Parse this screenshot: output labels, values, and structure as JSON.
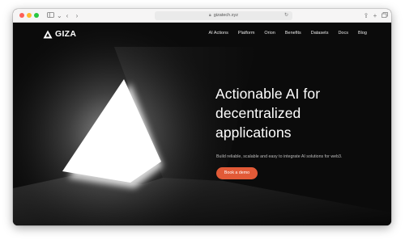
{
  "browser": {
    "url": "gizatech.xyz",
    "icons": {
      "sidebar": "sidebar-icon",
      "back": "chevron-left-icon",
      "forward": "chevron-right-icon",
      "lock": "lock-icon",
      "reload": "reload-icon",
      "share": "share-icon",
      "new_tab": "plus-icon",
      "tabs": "tabs-icon"
    }
  },
  "nav": {
    "logo": "GIZA",
    "items": [
      "AI Actions",
      "Platform",
      "Orion",
      "Benefits",
      "Datasets",
      "Docs",
      "Blog"
    ]
  },
  "hero": {
    "headline_lines": [
      "Actionable AI for",
      "decentralized",
      "applications"
    ],
    "subtitle": "Build reliable, scalable and easy to integrate AI solutions for web3.",
    "cta": "Book a demo"
  },
  "colors": {
    "background": "#0b0b0b",
    "accent": "#e25a37",
    "text": "#ffffff",
    "subtitle": "#bdbdbd"
  }
}
